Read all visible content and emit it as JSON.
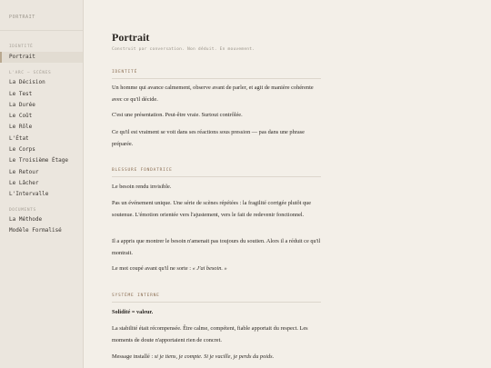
{
  "sidebar": {
    "brand": "PORTRAIT",
    "top_section_label": "IDENTITÉ",
    "top_items": [
      {
        "label": "Portrait"
      }
    ],
    "arc_section_label": "L'ARC — SCÈNES",
    "arc_items": [
      {
        "label": "La Décision"
      },
      {
        "label": "Le Test"
      },
      {
        "label": "La Durée"
      },
      {
        "label": "Le Coût"
      },
      {
        "label": "Le Rôle"
      },
      {
        "label": "L'État"
      },
      {
        "label": "Le Corps"
      },
      {
        "label": "Le Troisième Étage"
      },
      {
        "label": "Le Retour"
      },
      {
        "label": "Le Lâcher"
      },
      {
        "label": "L'Intervalle"
      }
    ],
    "docs_section_label": "DOCUMENTS",
    "doc_items": [
      {
        "label": "La Méthode"
      },
      {
        "label": "Modèle Formalisé"
      }
    ]
  },
  "main": {
    "title": "Portrait",
    "subtitle": "Construit par conversation. Non déduit. En mouvement.",
    "sections": [
      {
        "heading": "IDENTITÉ",
        "paragraphs": [
          "Un homme qui avance calmement, observe avant de parler, et agit de manière cohérente avec ce qu'il décide.",
          "C'est une présentation. Peut-être vraie. Surtout contrôlée.",
          "Ce qu'il est vraiment se voit dans ses réactions sous pression — pas dans une phrase préparée."
        ]
      },
      {
        "heading": "BLESSURE FONDATRICE",
        "paragraphs": [
          "Le besoin rendu invisible.",
          "Pas un événement unique. Une série de scènes répétées : la fragilité corrigée plutôt que soutenue. L'émotion orientée vers l'ajustement, vers le fait de redevenir fonctionnel.",
          "Il a appris que montrer le besoin n'amenait pas toujours du soutien. Alors il a réduit ce qu'il montrait."
        ],
        "quote_prefix": "Le mot coupé avant qu'il ne sorte : ",
        "quote": "« J'ai besoin. »"
      },
      {
        "heading": "SYSTÈME INTERNE",
        "bold_line": "Solidité = valeur.",
        "paragraphs": [
          "La stabilité était récompensée. Être calme, compétent, fiable apportait du respect. Les moments de doute n'apportaient rien de concret."
        ],
        "message_prefix": "Message installé : ",
        "message": "si je tiens, je compte. Si je vacille, je perds du poids."
      }
    ]
  }
}
